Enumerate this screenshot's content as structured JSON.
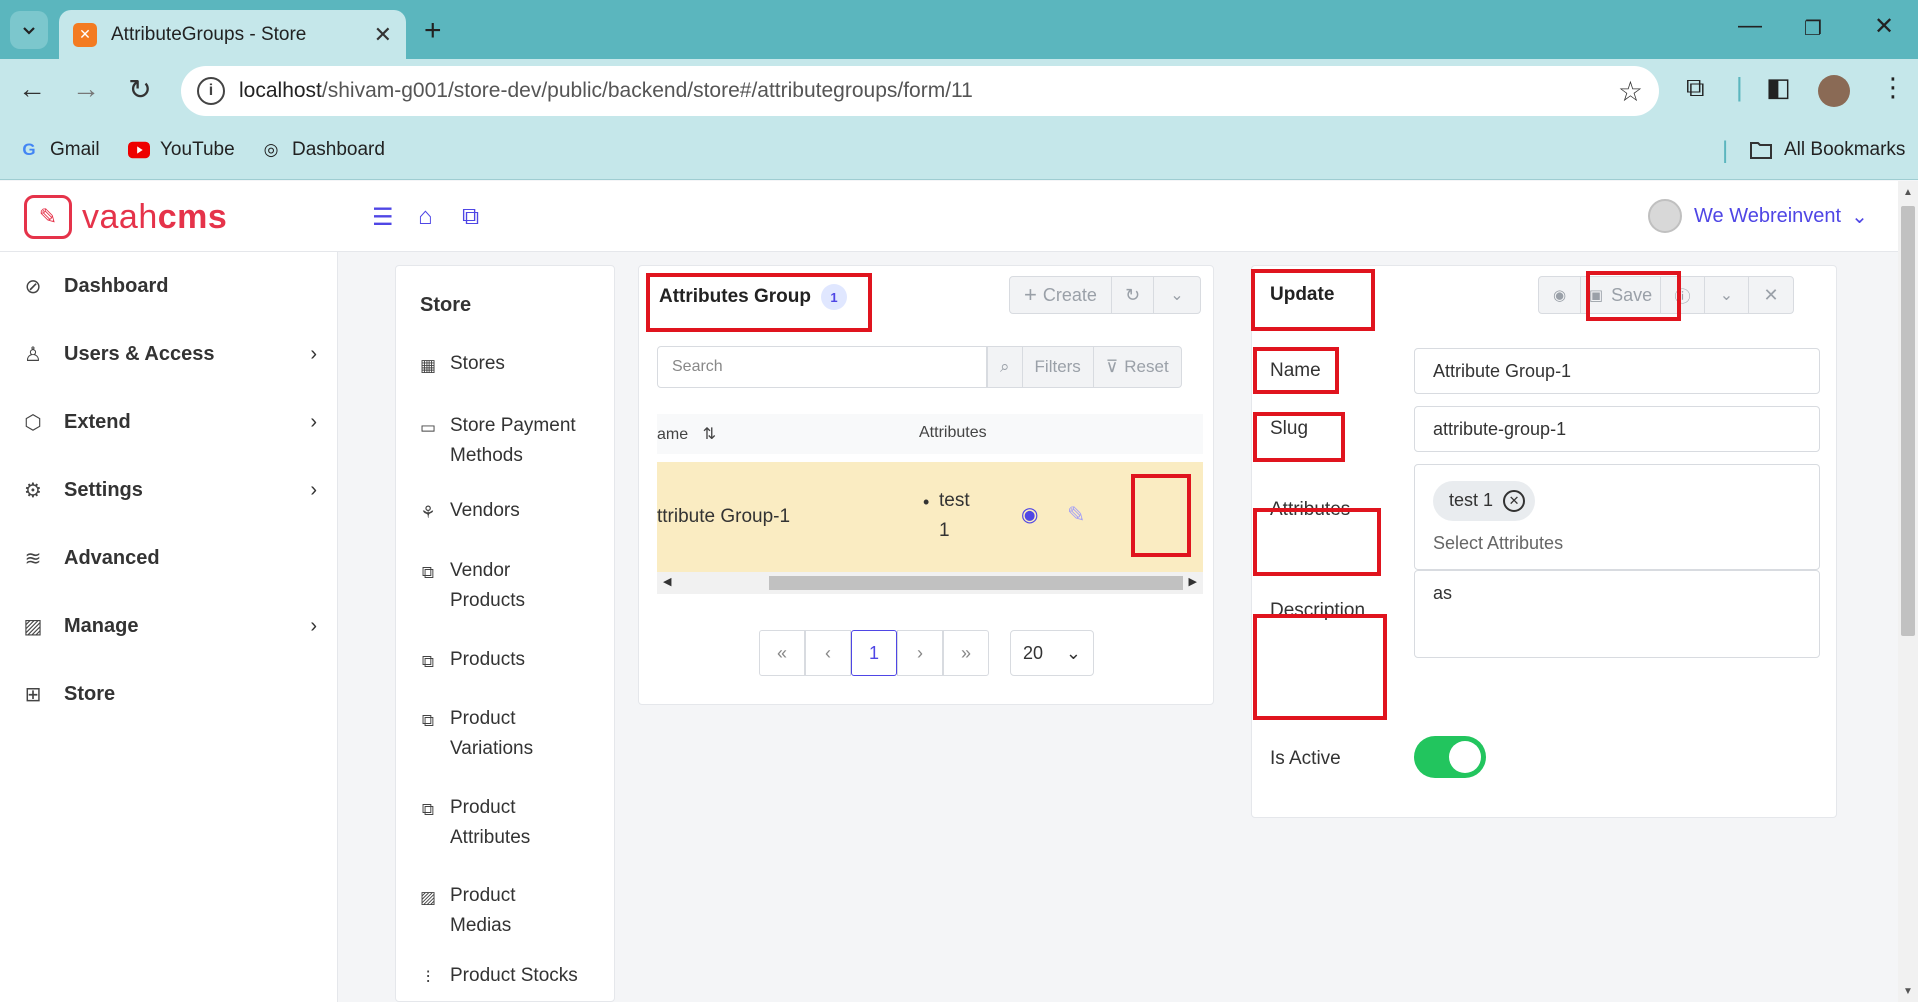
{
  "browser": {
    "tab_title": "AttributeGroups - Store",
    "url_host": "localhost",
    "url_path": "/shivam-g001/store-dev/public/backend/store#/attributegroups/form/11",
    "bookmarks": [
      "Gmail",
      "YouTube",
      "Dashboard"
    ],
    "all_bookmarks": "All Bookmarks"
  },
  "header": {
    "logo_light": "vaah",
    "logo_bold": "cms",
    "user_name": "We Webreinvent"
  },
  "sidebar": {
    "items": [
      {
        "label": "Dashboard",
        "icon": "compass-icon",
        "chevron": false
      },
      {
        "label": "Users & Access",
        "icon": "user-icon",
        "chevron": true
      },
      {
        "label": "Extend",
        "icon": "box-icon",
        "chevron": true
      },
      {
        "label": "Settings",
        "icon": "gear-icon",
        "chevron": true
      },
      {
        "label": "Advanced",
        "icon": "database-icon",
        "chevron": false
      },
      {
        "label": "Manage",
        "icon": "image-icon",
        "chevron": true
      },
      {
        "label": "Store",
        "icon": "grid-icon",
        "chevron": false
      }
    ]
  },
  "store_menu": {
    "title": "Store",
    "items": [
      {
        "line1": "Stores",
        "line2": ""
      },
      {
        "line1": "Store Payment",
        "line2": "Methods"
      },
      {
        "line1": "Vendors",
        "line2": ""
      },
      {
        "line1": "Vendor",
        "line2": "Products"
      },
      {
        "line1": "Products",
        "line2": ""
      },
      {
        "line1": "Product",
        "line2": "Variations"
      },
      {
        "line1": "Product",
        "line2": "Attributes"
      },
      {
        "line1": "Product",
        "line2": "Medias"
      },
      {
        "line1": "Product Stocks",
        "line2": ""
      }
    ]
  },
  "list": {
    "title": "Attributes Group",
    "count": "1",
    "create_label": "Create",
    "search_placeholder": "Search",
    "filters_label": "Filters",
    "reset_label": "Reset",
    "col_name": "ame",
    "col_attributes": "Attributes",
    "row_name": "ttribute Group-1",
    "row_attr_line1": "test",
    "row_attr_line2": "1",
    "current_page": "1",
    "per_page": "20"
  },
  "form": {
    "title": "Update",
    "save_label": "Save",
    "name_label": "Name",
    "name_value": "Attribute Group-1",
    "slug_label": "Slug",
    "slug_value": "attribute-group-1",
    "attributes_label": "Attributes",
    "attribute_chip": "test 1",
    "attributes_placeholder": "Select Attributes",
    "description_label": "Description",
    "description_value": "as",
    "active_label": "Is Active",
    "is_active": true
  },
  "colors": {
    "accent": "#4f46e5",
    "brand": "#e5334a",
    "toggle_on": "#22c55e",
    "highlight_row": "#faecc2",
    "annotation": "#e0141e"
  }
}
